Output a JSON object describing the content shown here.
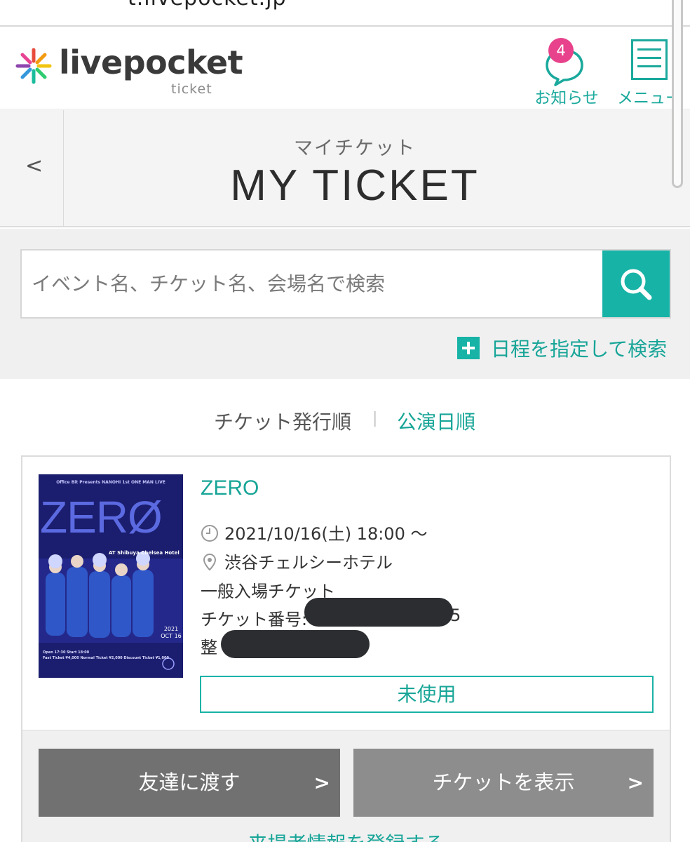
{
  "browser": {
    "url": "t.livepocket.jp"
  },
  "header": {
    "logo_text": "livepocket",
    "logo_sub": "ticket",
    "notice_label": "お知らせ",
    "notice_count": "4",
    "menu_label": "メニュー"
  },
  "titlebar": {
    "back_icon": "<",
    "subtitle": "マイチケット",
    "title": "MY TICKET"
  },
  "search": {
    "placeholder": "イベント名、チケット名、会場名で検索",
    "date_search_label": "日程を指定して検索"
  },
  "sort": {
    "issued_label": "チケット発行順",
    "separator": "|",
    "performance_label": "公演日順"
  },
  "ticket": {
    "event_name": "ZERO",
    "datetime": "2021/10/16(土) 18:00 〜",
    "venue": "渋谷チェルシーホテル",
    "ticket_type": "一般入場チケット",
    "ticket_number_label": "チケット番号:",
    "ticket_number_tail": "5",
    "seat_label_partial": "整",
    "status": "未使用",
    "poster": {
      "top_text": "Office Bit Presents NANOHI 1st ONE MAN LIVE",
      "zero": "ZERØ",
      "venue": "AT Shibuya Chelsea Hotel",
      "date": "2021 OCT 16",
      "info1": "Open 17:30 Start 18:00",
      "info2": "Fast Ticket ¥4,000 Normal Ticket ¥2,000 Discount Ticket ¥1,000"
    }
  },
  "actions": {
    "give_label": "友達に渡す",
    "show_label": "チケットを表示",
    "chevron": ">",
    "register_label": "来場者情報を登録する"
  },
  "colors": {
    "accent": "#17b3a6",
    "badge": "#e8428c",
    "button_dark": "#717171",
    "button_light": "#8d8d8d"
  },
  "icons": [
    "chat-bubble-icon",
    "hamburger-menu-icon",
    "chevron-left-icon",
    "search-icon",
    "plus-icon",
    "clock-icon",
    "map-pin-icon",
    "chevron-right-icon"
  ]
}
